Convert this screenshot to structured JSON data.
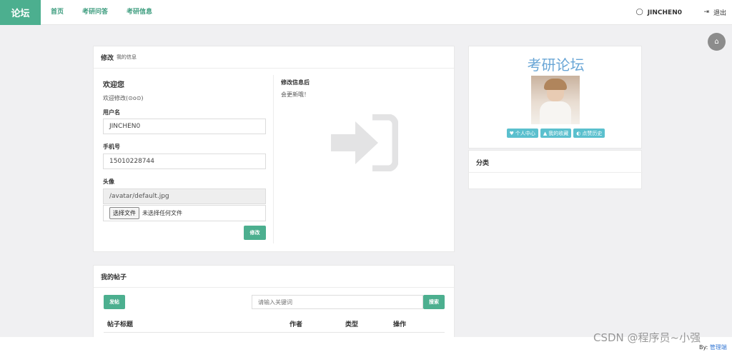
{
  "nav": {
    "brand": "论坛",
    "links": [
      "首页",
      "考研问答",
      "考研信息"
    ],
    "username": "JINCHEN0",
    "logout": "退出"
  },
  "edit_panel": {
    "title": "修改",
    "subtitle": "我的信息",
    "welcome": "欢迎您",
    "welcome_sub": "欢迎修改(⊙o⊙)",
    "username_label": "用户名",
    "username_value": "JINCHEN0",
    "phone_label": "手机号",
    "phone_value": "15010228744",
    "avatar_label": "头像",
    "avatar_value": "/avatar/default.jpg",
    "file_button": "选择文件",
    "file_status": "未选择任何文件",
    "submit": "修改",
    "right_title": "修改信息后",
    "right_sub": "会更新哦！"
  },
  "profile": {
    "site_title": "考研论坛",
    "tags": [
      "个人中心",
      "我的收藏",
      "点赞历史"
    ],
    "category_title": "分类"
  },
  "posts_panel": {
    "title": "我的帖子",
    "new_button": "发帖",
    "search_placeholder": "请输入关键词",
    "search_button": "搜索",
    "columns": [
      "帖子标题",
      "作者",
      "类型",
      "操作"
    ]
  },
  "footer": {
    "watermark": "CSDN @程序员~小强",
    "by_label": "By:",
    "by_link": "管理端"
  },
  "colors": {
    "accent": "#4caf8f",
    "tag": "#5bc0ce",
    "site_title": "#6aa6d6"
  }
}
